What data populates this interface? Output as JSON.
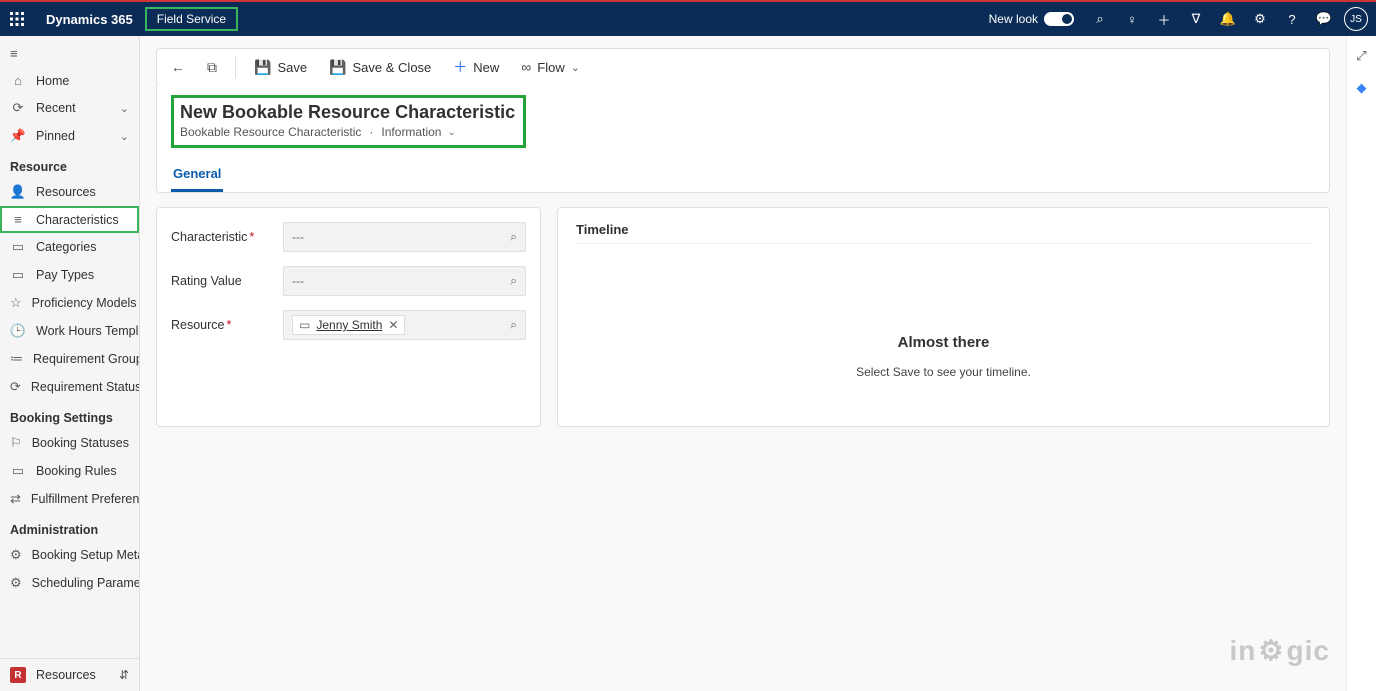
{
  "topbar": {
    "brand": "Dynamics 365",
    "app": "Field Service",
    "newlook_label": "New look",
    "avatar_initials": "JS"
  },
  "sidebar": {
    "primary": [
      {
        "icon": "⌂",
        "label": "Home"
      },
      {
        "icon": "⟳",
        "label": "Recent",
        "expandable": true
      },
      {
        "icon": "📌",
        "label": "Pinned",
        "expandable": true
      }
    ],
    "section_resource": "Resource",
    "resource_items": [
      {
        "icon": "👤",
        "label": "Resources"
      },
      {
        "icon": "≡",
        "label": "Characteristics",
        "active": true
      },
      {
        "icon": "▭",
        "label": "Categories"
      },
      {
        "icon": "▭",
        "label": "Pay Types"
      },
      {
        "icon": "☆",
        "label": "Proficiency Models"
      },
      {
        "icon": "🕒",
        "label": "Work Hours Templates"
      },
      {
        "icon": "≔",
        "label": "Requirement Group ..."
      },
      {
        "icon": "⟳",
        "label": "Requirement Statuses"
      }
    ],
    "section_booking": "Booking Settings",
    "booking_items": [
      {
        "icon": "⚐",
        "label": "Booking Statuses"
      },
      {
        "icon": "▭",
        "label": "Booking Rules"
      },
      {
        "icon": "⇄",
        "label": "Fulfillment Preferences"
      }
    ],
    "section_admin": "Administration",
    "admin_items": [
      {
        "icon": "⚙",
        "label": "Booking Setup Meta..."
      },
      {
        "icon": "⚙",
        "label": "Scheduling Paramete..."
      }
    ],
    "footer": {
      "icon": "R",
      "label": "Resources"
    }
  },
  "commands": {
    "save": "Save",
    "save_close": "Save & Close",
    "new": "New",
    "flow": "Flow"
  },
  "form": {
    "title": "New Bookable Resource Characteristic",
    "entity": "Bookable Resource Characteristic",
    "view": "Information",
    "tab_general": "General",
    "fields": {
      "characteristic_label": "Characteristic",
      "characteristic_placeholder": "---",
      "rating_label": "Rating Value",
      "rating_placeholder": "---",
      "resource_label": "Resource",
      "resource_value": "Jenny Smith"
    }
  },
  "timeline": {
    "title": "Timeline",
    "heading": "Almost there",
    "sub": "Select Save to see your timeline."
  },
  "watermark": {
    "pre": "in",
    "post": "gic"
  }
}
